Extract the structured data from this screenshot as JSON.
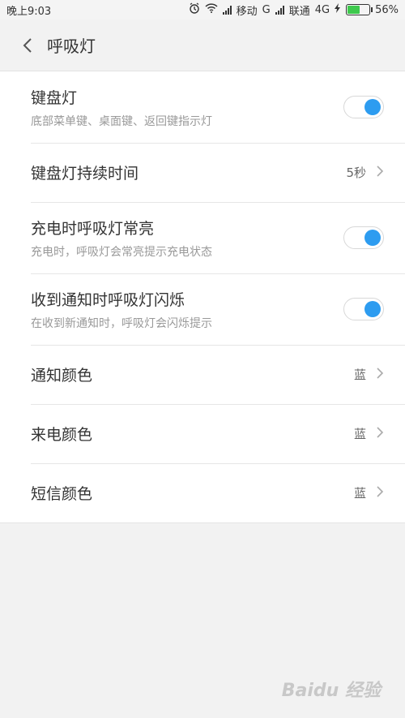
{
  "status_bar": {
    "time": "晚上9:03",
    "carrier1": "移动",
    "net1": "G",
    "carrier2": "联通",
    "net2": "4G",
    "battery": "56%",
    "battery_fraction": 0.56,
    "battery_color": "#3ec94d"
  },
  "header": {
    "title": "呼吸灯"
  },
  "accent_color": "#2d9cf0",
  "settings": [
    {
      "title": "键盘灯",
      "subtitle": "底部菜单键、桌面键、返回键指示灯",
      "type": "toggle",
      "on": true
    },
    {
      "title": "键盘灯持续时间",
      "type": "value",
      "value": "5秒"
    },
    {
      "title": "充电时呼吸灯常亮",
      "subtitle": "充电时，呼吸灯会常亮提示充电状态",
      "type": "toggle",
      "on": true
    },
    {
      "title": "收到通知时呼吸灯闪烁",
      "subtitle": "在收到新通知时，呼吸灯会闪烁提示",
      "type": "toggle",
      "on": true
    },
    {
      "title": "通知颜色",
      "type": "value",
      "value": "蓝"
    },
    {
      "title": "来电颜色",
      "type": "value",
      "value": "蓝"
    },
    {
      "title": "短信颜色",
      "type": "value",
      "value": "蓝"
    }
  ],
  "watermark": "Baidu经验"
}
